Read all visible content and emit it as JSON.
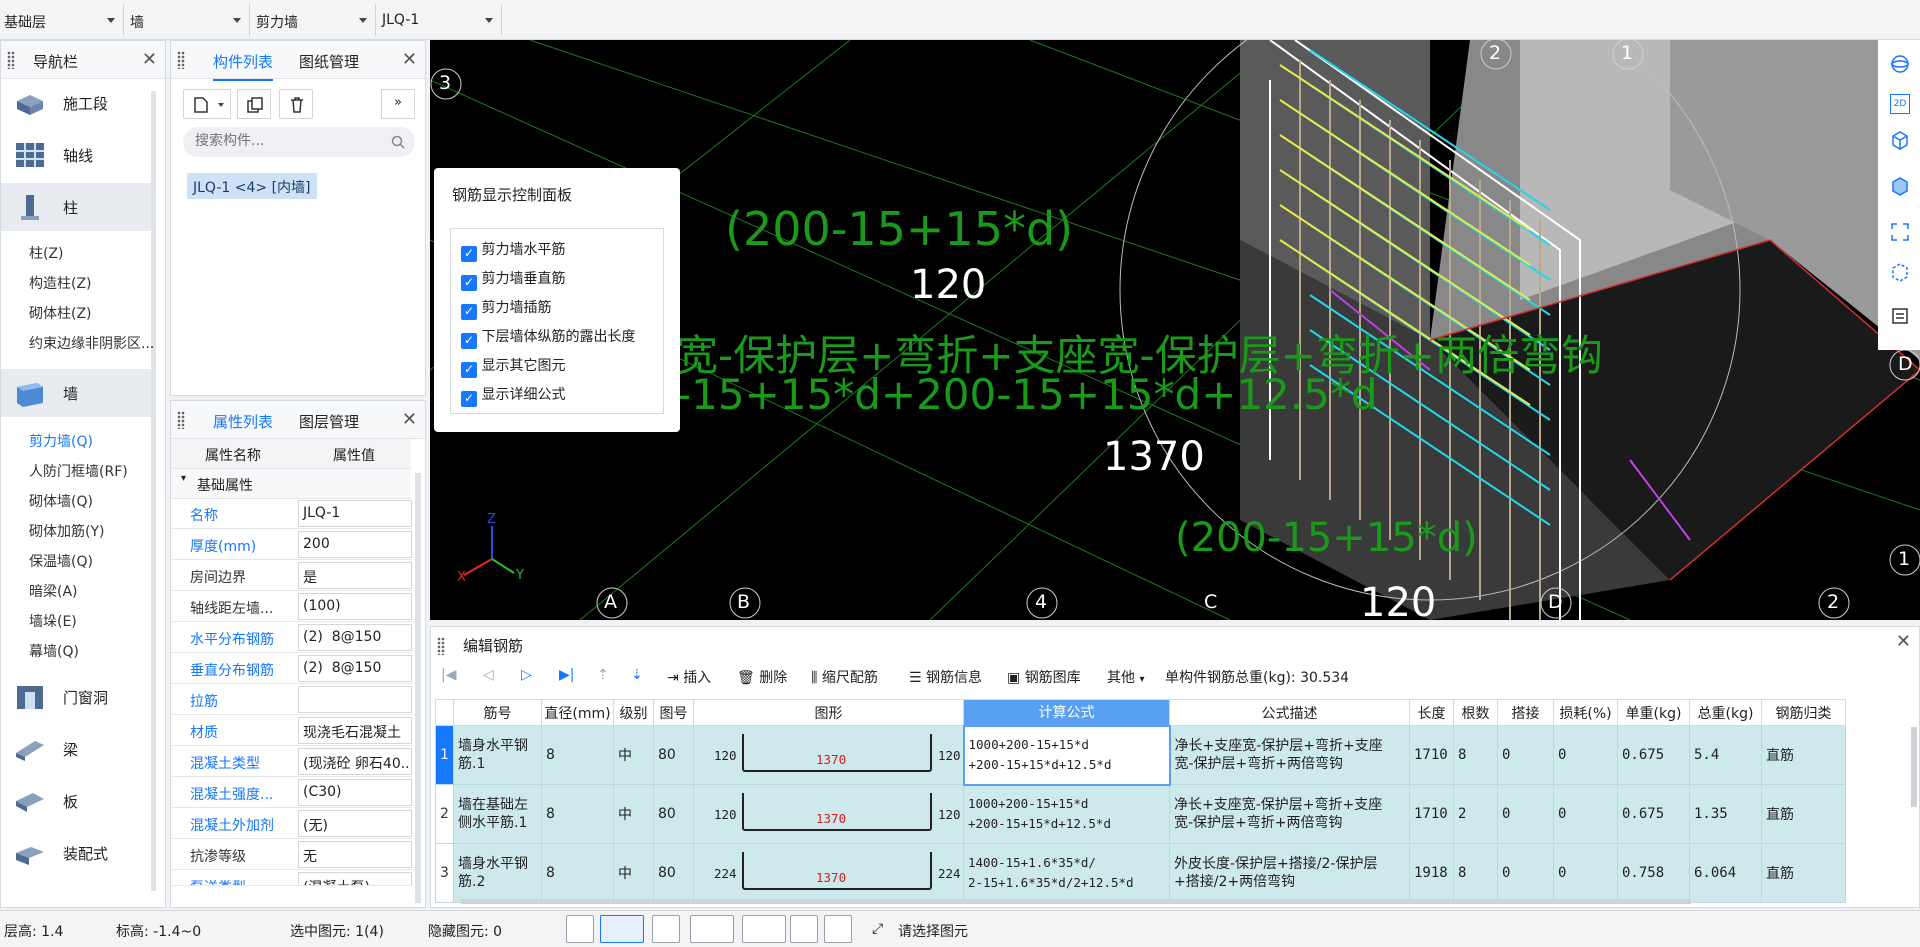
{
  "topbar": {
    "selectors": [
      "基础层",
      "墙",
      "剪力墙",
      "JLQ-1"
    ]
  },
  "nav": {
    "title": "导航栏",
    "big": [
      "施工段",
      "轴线",
      "柱",
      "墙",
      "门窗洞",
      "梁",
      "板",
      "装配式"
    ],
    "col_items": [
      "柱(Z)",
      "构造柱(Z)",
      "砌体柱(Z)",
      "约束边缘非阴影区..."
    ],
    "wall_items": [
      "剪力墙(Q)",
      "人防门框墙(RF)",
      "砌体墙(Q)",
      "砌体加筋(Y)",
      "保温墙(Q)",
      "暗梁(A)",
      "墙垛(E)",
      "幕墙(Q)"
    ]
  },
  "comp": {
    "tab1": "构件列表",
    "tab2": "图纸管理",
    "search_placeholder": "搜索构件...",
    "item": "JLQ-1 <4> [内墙]"
  },
  "props": {
    "tab1": "属性列表",
    "tab2": "图层管理",
    "col_name": "属性名称",
    "col_value": "属性值",
    "group": "基础属性",
    "rows": [
      {
        "k": "名称",
        "v": "JLQ-1"
      },
      {
        "k": "厚度(mm)",
        "v": "200"
      },
      {
        "k": "房间边界",
        "v": "是"
      },
      {
        "k": "轴线距左墙...",
        "v": "(100)"
      },
      {
        "k": "水平分布钢筋",
        "v": "(2)  8@150"
      },
      {
        "k": "垂直分布钢筋",
        "v": "(2)  8@150"
      },
      {
        "k": "拉筋",
        "v": ""
      },
      {
        "k": "材质",
        "v": "现浇毛石混凝土"
      },
      {
        "k": "混凝土类型",
        "v": "(现浇砼 卵石40..."
      },
      {
        "k": "混凝土强度...",
        "v": "(C30)"
      },
      {
        "k": "混凝土外加剂",
        "v": "(无)"
      },
      {
        "k": "抗渗等级",
        "v": "无"
      },
      {
        "k": "泵送类型",
        "v": "(混凝土泵)"
      }
    ]
  },
  "viewport": {
    "axis_top": [
      "2",
      "1"
    ],
    "axis_left": "3",
    "axis_bottom": [
      "A",
      "B",
      "4",
      "C",
      "D",
      "2"
    ],
    "axis_right": [
      "D",
      "1"
    ],
    "dims": [
      "(200-15+15*d)",
      "120",
      "宽-保护层+弯折+支座宽-保护层+弯折+两倍弯钩",
      "-15+15*d+200-15+15*d+12.5*d",
      "1370",
      "(200-15+15*d)",
      "120"
    ],
    "axes_labels": [
      "Z",
      "X",
      "Y"
    ]
  },
  "rebar_panel": {
    "title": "钢筋显示控制面板",
    "items": [
      "剪力墙水平筋",
      "剪力墙垂直筋",
      "剪力墙插筋",
      "下层墙体纵筋的露出长度",
      "显示其它图元",
      "显示详细公式"
    ]
  },
  "editor": {
    "title": "编辑钢筋",
    "toolbar": {
      "insert": "插入",
      "delete": "删除",
      "scale": "缩尺配筋",
      "info": "钢筋信息",
      "lib": "钢筋图库",
      "other": "其他",
      "total": "单构件钢筋总重(kg): 30.534"
    },
    "headers": [
      "筋号",
      "直径(mm)",
      "级别",
      "图号",
      "图形",
      "计算公式",
      "公式描述",
      "长度",
      "根数",
      "搭接",
      "损耗(%)",
      "单重(kg)",
      "总重(kg)",
      "钢筋归类"
    ],
    "rows": [
      {
        "n": "1",
        "name": "墙身水平钢筋.1",
        "dia": "8",
        "grade": "中",
        "fig": "80",
        "l": "120",
        "mid": "1370",
        "r": "120",
        "f1": "1000+200-15+15*d",
        "f2": "+200-15+15*d+12.5*d",
        "d1": "净长+支座宽-保护层+弯折+支座",
        "d2": "宽-保护层+弯折+两倍弯钩",
        "len": "1710",
        "cnt": "8",
        "lap": "0",
        "loss": "0",
        "uw": "0.675",
        "tw": "5.4",
        "cls": "直筋"
      },
      {
        "n": "2",
        "name": "墙在基础左侧水平筋.1",
        "dia": "8",
        "grade": "中",
        "fig": "80",
        "l": "120",
        "mid": "1370",
        "r": "120",
        "f1": "1000+200-15+15*d",
        "f2": "+200-15+15*d+12.5*d",
        "d1": "净长+支座宽-保护层+弯折+支座",
        "d2": "宽-保护层+弯折+两倍弯钩",
        "len": "1710",
        "cnt": "2",
        "lap": "0",
        "loss": "0",
        "uw": "0.675",
        "tw": "1.35",
        "cls": "直筋"
      },
      {
        "n": "3",
        "name": "墙身水平钢筋.2",
        "dia": "8",
        "grade": "中",
        "fig": "80",
        "l": "224",
        "mid": "1370",
        "r": "224",
        "f1": "1400-15+1.6*35*d/",
        "f2": "2-15+1.6*35*d/2+12.5*d",
        "d1": "外皮长度-保护层+搭接/2-保护层",
        "d2": "+搭接/2+两倍弯钩",
        "len": "1918",
        "cnt": "8",
        "lap": "0",
        "loss": "0",
        "uw": "0.758",
        "tw": "6.064",
        "cls": "直筋"
      }
    ]
  },
  "status": {
    "floor_h": "层高:  1.4",
    "elev": "标高:  -1.4~0",
    "selected": "选中图元: 1(4)",
    "hidden": "隐藏图元:  0",
    "hint": "请选择图元"
  }
}
